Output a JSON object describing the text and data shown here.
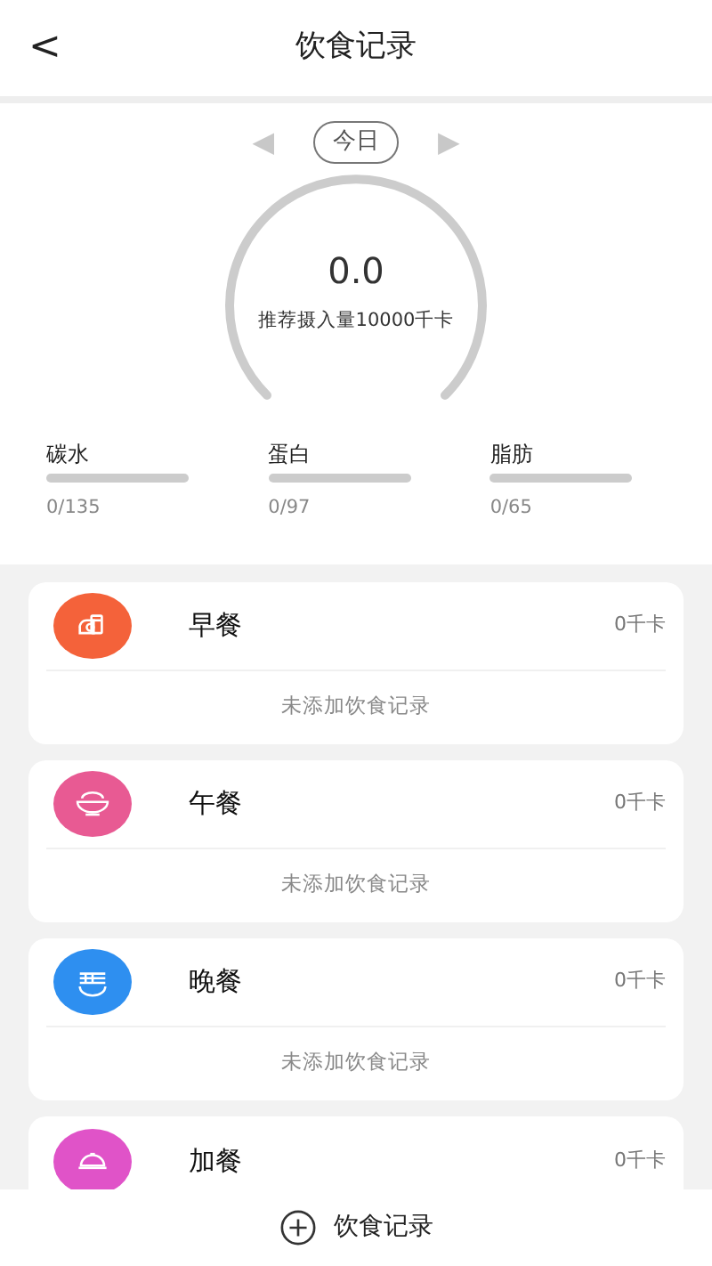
{
  "header": {
    "back": "<",
    "title": "饮食记录"
  },
  "date": {
    "prev": "◀",
    "label": "今日",
    "next": "▶"
  },
  "gauge": {
    "value": "0.0",
    "caption": "推荐摄入量10000千卡"
  },
  "macros": [
    {
      "name": "碳水",
      "level": 0,
      "reading": "0/135"
    },
    {
      "name": "蛋白",
      "level": 0,
      "reading": "0/97"
    },
    {
      "name": "脂肪",
      "level": 0,
      "reading": "0/65"
    }
  ],
  "meals": [
    {
      "kind": "breakfast",
      "color": "#f4623a",
      "name": "早餐",
      "calories": "0千卡",
      "empty_text": "未添加饮食记录"
    },
    {
      "kind": "lunch",
      "color": "#e85a93",
      "name": "午餐",
      "calories": "0千卡",
      "empty_text": "未添加饮食记录"
    },
    {
      "kind": "dinner",
      "color": "#2e8ff0",
      "name": "晚餐",
      "calories": "0千卡",
      "empty_text": "未添加饮食记录"
    },
    {
      "kind": "snack",
      "color": "#e053c8",
      "name": "加餐",
      "calories": "0千卡"
    }
  ],
  "bottom_button": {
    "label": "饮食记录"
  }
}
